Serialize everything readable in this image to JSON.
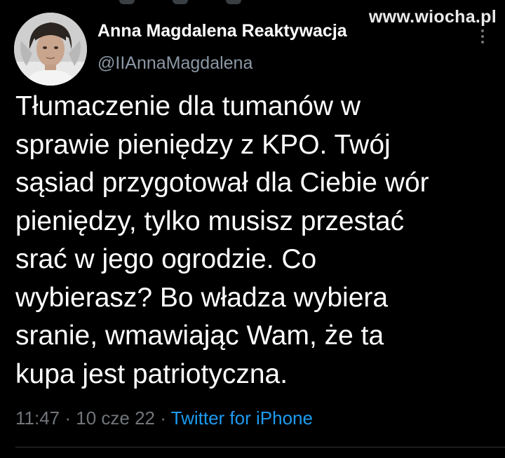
{
  "watermark": "www.wiocha.pl",
  "author": {
    "name": "Anna Magdalena Reaktywacja",
    "handle": "@IIAnnaMagdalena",
    "avatar_icon": "profile-photo"
  },
  "tweet": {
    "lines": [
      "Tłumaczenie dla tumanów w",
      "sprawie pieniędzy z KPO. Twój",
      "sąsiad przygotował dla Ciebie wór",
      "pieniędzy, tylko musisz przestać",
      "srać w jego ogrodzie. Co",
      "wybierasz? Bo władza wybiera",
      "sranie, wmawiając Wam, że ta",
      "kupa jest patriotyczna."
    ]
  },
  "meta": {
    "time": "11:47",
    "separator": " · ",
    "date": "10 cze 22",
    "source": "Twitter for iPhone"
  },
  "colors": {
    "background": "#000000",
    "text": "#ffffff",
    "secondary": "#71767b",
    "link": "#1d9bf0"
  },
  "icons": {
    "more": "more-dots-icon"
  }
}
